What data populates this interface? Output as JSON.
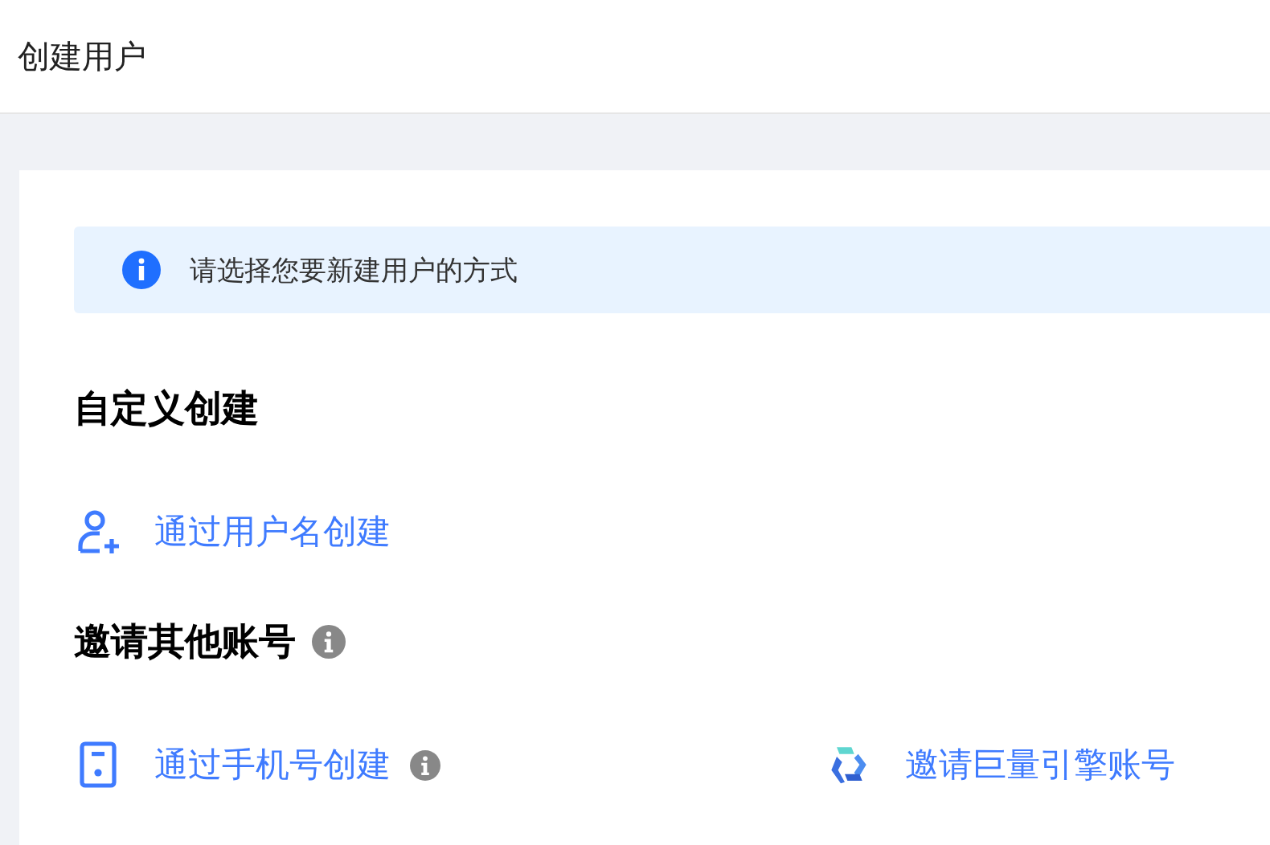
{
  "header": {
    "title": "创建用户"
  },
  "alert": {
    "text": "请选择您要新建用户的方式"
  },
  "sections": [
    {
      "heading": "自定义创建",
      "info": false,
      "options": [
        {
          "kind": "user",
          "label": "通过用户名创建",
          "info": false
        }
      ]
    },
    {
      "heading": "邀请其他账号",
      "info": true,
      "options": [
        {
          "kind": "phone",
          "label": "通过手机号创建",
          "info": true
        },
        {
          "kind": "engine",
          "label": "邀请巨量引擎账号",
          "info": false
        }
      ]
    }
  ]
}
